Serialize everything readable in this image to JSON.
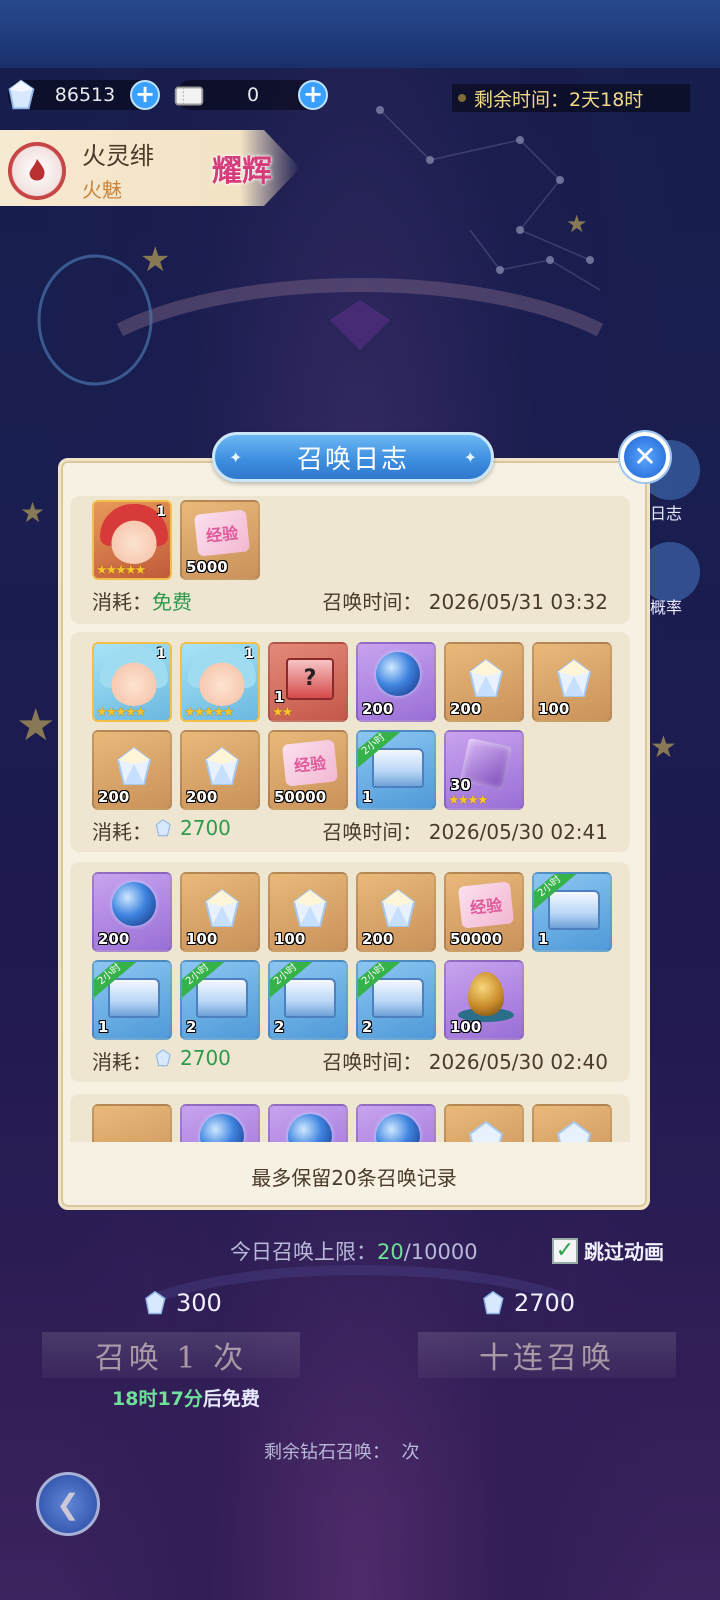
{
  "currency": {
    "gems": "86513",
    "tickets": "0"
  },
  "remaining_time": {
    "label": "剩余时间：",
    "value": "2天18时"
  },
  "character": {
    "name": "火灵绯",
    "element": "火魅",
    "rank": "耀辉"
  },
  "side_buttons": {
    "log_label": "日志",
    "rate_label": "概率"
  },
  "modal": {
    "title": "召唤日志",
    "footer": "最多保留20条召唤记录",
    "cost_label": "消耗：",
    "time_label": "召唤时间：",
    "entries": [
      {
        "cost": "免费",
        "time": "2026/05/31 03:32",
        "items": [
          {
            "type": "character-red",
            "count": "",
            "corner": "1",
            "stars": "★★★★★"
          },
          {
            "type": "exp",
            "count": "5000",
            "label": "经验"
          }
        ]
      },
      {
        "cost": "2700",
        "time": "2026/05/30 02:41",
        "items": [
          {
            "type": "character-blue",
            "corner": "1",
            "stars": "★★★★★"
          },
          {
            "type": "character-blue",
            "corner": "1",
            "stars": "★★★★★"
          },
          {
            "type": "mystery-box",
            "count": "1",
            "stars": "★★"
          },
          {
            "type": "orb",
            "count": "200"
          },
          {
            "type": "crystal",
            "count": "200"
          },
          {
            "type": "crystal",
            "count": "100"
          },
          {
            "type": "crystal",
            "count": "200"
          },
          {
            "type": "crystal",
            "count": "200"
          },
          {
            "type": "exp",
            "count": "50000",
            "label": "经验"
          },
          {
            "type": "chest",
            "count": "1",
            "ribbon": "2小时"
          },
          {
            "type": "cube",
            "count": "30",
            "stars": "★★★★"
          }
        ]
      },
      {
        "cost": "2700",
        "time": "2026/05/30 02:40",
        "items": [
          {
            "type": "orb",
            "count": "200"
          },
          {
            "type": "crystal",
            "count": "100"
          },
          {
            "type": "crystal",
            "count": "100"
          },
          {
            "type": "crystal",
            "count": "200"
          },
          {
            "type": "exp",
            "count": "50000",
            "label": "经验"
          },
          {
            "type": "chest",
            "count": "1",
            "ribbon": "2小时"
          },
          {
            "type": "chest",
            "count": "1",
            "ribbon": "2小时"
          },
          {
            "type": "chest-gold",
            "count": "2",
            "ribbon": "2小时"
          },
          {
            "type": "chest-gold",
            "count": "2",
            "ribbon": "2小时"
          },
          {
            "type": "chest-gold",
            "count": "2",
            "ribbon": "2小时"
          },
          {
            "type": "egg",
            "count": "100"
          }
        ]
      }
    ]
  },
  "bottom": {
    "daily_label": "今日召唤上限：",
    "daily_used": "20",
    "daily_max": "/10000",
    "skip_label": "跳过动画",
    "single_cost": "300",
    "ten_cost": "2700",
    "single_label": "召唤 1 次",
    "ten_label": "十连召唤",
    "free_time": "18时17分",
    "free_suffix": "后免费",
    "diamond_label_pre": "剩余钻石召唤：",
    "diamond_count": "",
    "diamond_label_post": "次"
  },
  "colors": {
    "accent_blue": "#3f8fe0",
    "panel_bg": "#f7f1e3",
    "entry_bg": "#efe6d2",
    "free_green": "#2e9a4e"
  }
}
